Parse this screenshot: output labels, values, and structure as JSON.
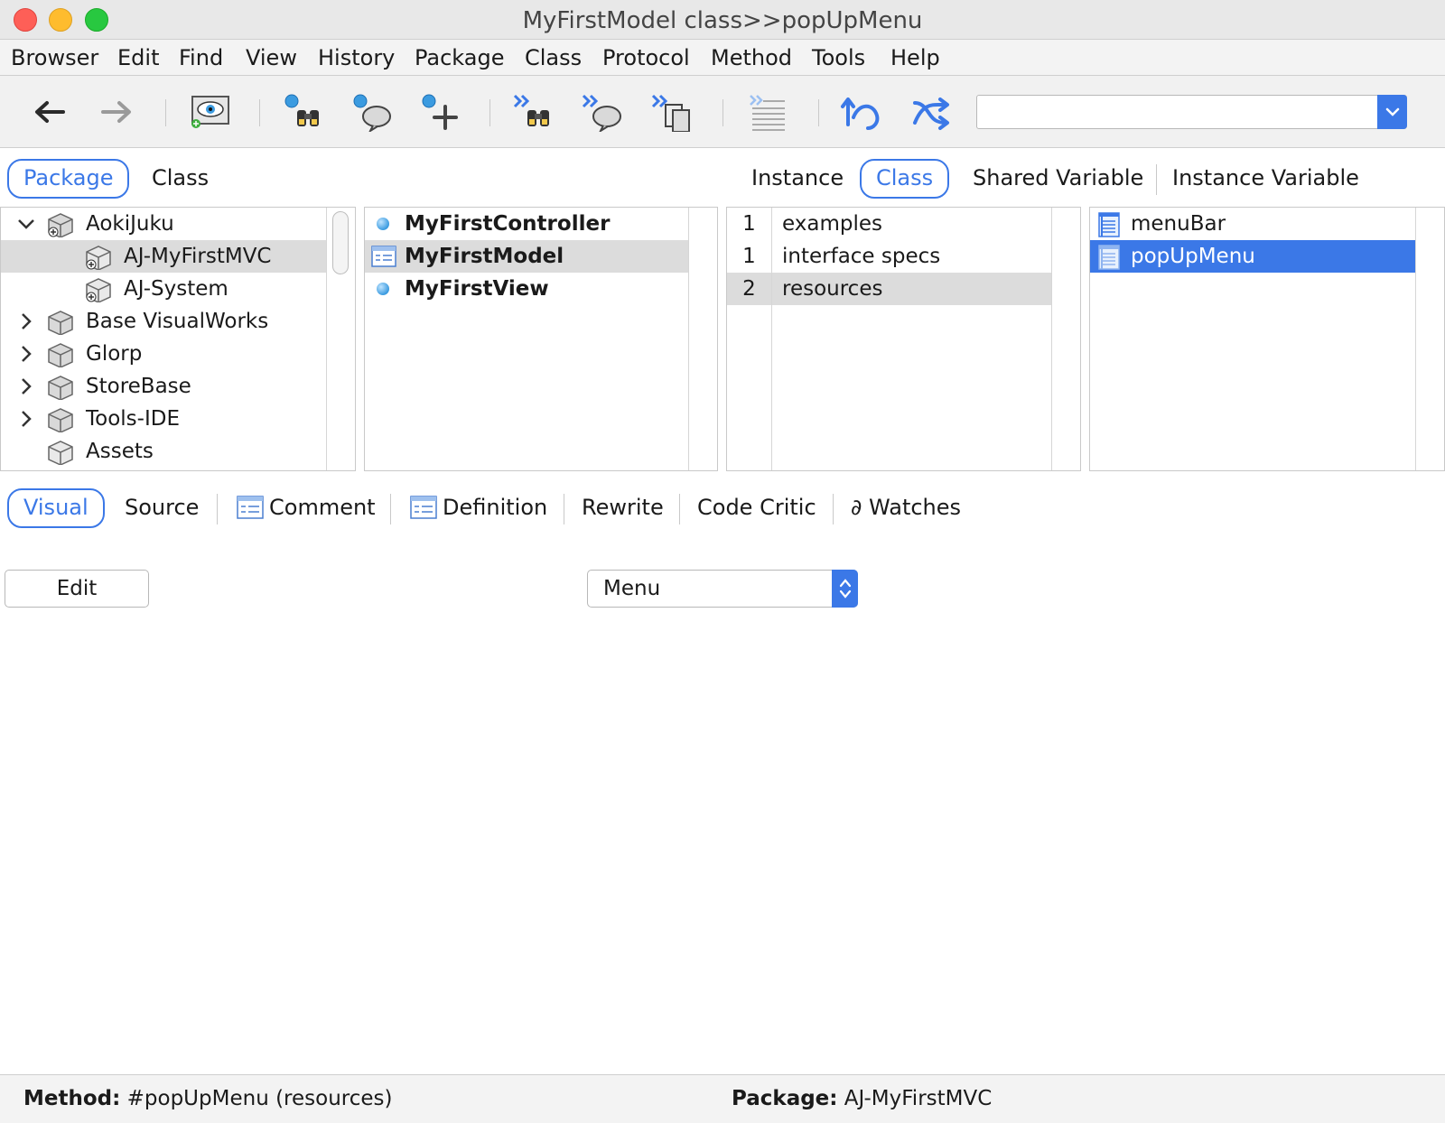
{
  "window": {
    "title": "MyFirstModel class>>popUpMenu"
  },
  "menubar": [
    "Browser",
    "Edit",
    "Find",
    "View",
    "History",
    "Package",
    "Class",
    "Protocol",
    "Method",
    "Tools",
    "Help"
  ],
  "toolbar": {
    "buttons": [
      "back-arrow-icon",
      "forward-arrow-icon",
      "eye-icon",
      "find-binoculars-icon",
      "find-speech-icon",
      "add-plus-icon",
      "forward-binoculars-icon",
      "forward-speech-icon",
      "forward-documents-icon",
      "lines-icon",
      "sync-icon",
      "shuffle-icon"
    ],
    "search_value": ""
  },
  "top_tabs": {
    "left": [
      "Package",
      "Class"
    ],
    "left_selected": "Package",
    "right": [
      "Instance",
      "Class",
      "Shared Variable",
      "Instance Variable"
    ],
    "right_selected": "Class"
  },
  "packages": [
    {
      "label": "AokiJuku",
      "expander": "expanded",
      "indent": 0
    },
    {
      "label": "AJ-MyFirstMVC",
      "expander": "none",
      "indent": 1,
      "selected": true
    },
    {
      "label": "AJ-System",
      "expander": "none",
      "indent": 1
    },
    {
      "label": "Base VisualWorks",
      "expander": "collapsed",
      "indent": 0
    },
    {
      "label": "Glorp",
      "expander": "collapsed",
      "indent": 0
    },
    {
      "label": "StoreBase",
      "expander": "collapsed",
      "indent": 0
    },
    {
      "label": "Tools-IDE",
      "expander": "collapsed",
      "indent": 0
    },
    {
      "label": "Assets",
      "expander": "none",
      "indent": 0
    }
  ],
  "classes": [
    {
      "label": "MyFirstController",
      "icon": "class-dot-icon"
    },
    {
      "label": "MyFirstModel",
      "icon": "class-table-icon",
      "selected": true
    },
    {
      "label": "MyFirstView",
      "icon": "class-dot-icon"
    }
  ],
  "protocols": [
    {
      "count": "1",
      "label": "examples"
    },
    {
      "count": "1",
      "label": "interface specs"
    },
    {
      "count": "2",
      "label": "resources",
      "selected": true
    }
  ],
  "methods": [
    {
      "label": "menuBar"
    },
    {
      "label": "popUpMenu",
      "selected": true
    }
  ],
  "bottom_tabs": {
    "items": [
      "Visual",
      "Source",
      "Comment",
      "Definition",
      "Rewrite",
      "Code Critic",
      "∂ Watches"
    ],
    "selected": "Visual"
  },
  "editor": {
    "edit_button": "Edit",
    "type_select": "Menu"
  },
  "status": {
    "method_label": "Method:",
    "method_value": "#popUpMenu (resources)",
    "package_label": "Package:",
    "package_value": "AJ-MyFirstMVC"
  },
  "colors": {
    "accent": "#3b78e7",
    "selection_grey": "#dcdcdc"
  }
}
